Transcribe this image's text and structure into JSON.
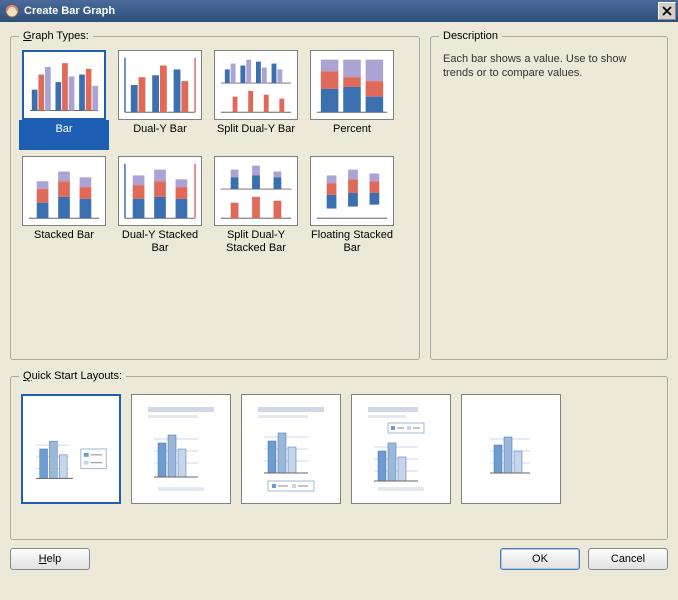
{
  "window": {
    "title": "Create Bar Graph"
  },
  "sections": {
    "graph_types_legend": "Graph Types:",
    "description_legend": "Description",
    "quick_start_legend": "Quick Start Layouts:"
  },
  "graph_types": [
    {
      "label": "Bar",
      "selected": true
    },
    {
      "label": "Dual-Y Bar"
    },
    {
      "label": "Split Dual-Y Bar"
    },
    {
      "label": "Percent"
    },
    {
      "label": "Stacked Bar"
    },
    {
      "label": "Dual-Y Stacked Bar"
    },
    {
      "label": "Split Dual-Y Stacked Bar"
    },
    {
      "label": "Floating Stacked Bar"
    }
  ],
  "description_text": "Each bar shows a value. Use to show trends or to compare values.",
  "quick_start_layouts": [
    {
      "selected": true
    },
    {},
    {},
    {},
    {}
  ],
  "buttons": {
    "help": "Help",
    "ok": "OK",
    "cancel": "Cancel"
  },
  "colors": {
    "blue": "#3b6fb0",
    "red": "#e06a5a",
    "purple": "#aaa3d4",
    "lightblue": "#9cb8d8"
  }
}
